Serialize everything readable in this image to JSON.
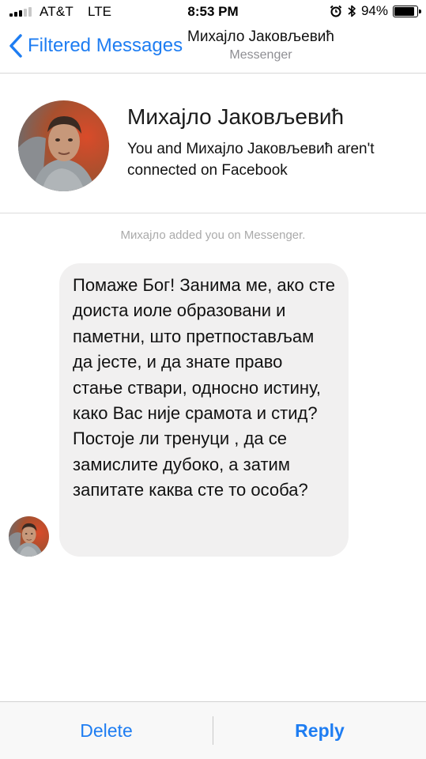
{
  "status_bar": {
    "carrier": "AT&T",
    "network": "LTE",
    "time": "8:53 PM",
    "battery_percent": "94%",
    "battery_level": 0.94,
    "signal_bars": 3,
    "signal_bars_total": 5,
    "icons": [
      "signal-icon",
      "alarm-icon",
      "bluetooth-icon",
      "battery-icon"
    ]
  },
  "nav": {
    "back_label": "Filtered Messages",
    "title": "Михајло Јаковљевић",
    "subtitle": "Messenger",
    "accent_color": "#1e7df2"
  },
  "profile": {
    "name": "Михајло Јаковљевић",
    "connection_note": "You and Михајло Јаковљевић aren't connected on Facebook"
  },
  "conversation": {
    "system_note": "Михајло added you on Messenger.",
    "message": "Помаже Бог! Занима ме, ако сте доиста иоле образовани и паметни, што претпостављам да јесте, и да знате право стање ствари, односно истину, како Вас није срамота и стид? Постоје ли тренуци , да се замислите дубоко, а затим запитате каква сте то особа?",
    "bubble_color": "#f1f0f0"
  },
  "actions": {
    "delete_label": "Delete",
    "reply_label": "Reply"
  }
}
